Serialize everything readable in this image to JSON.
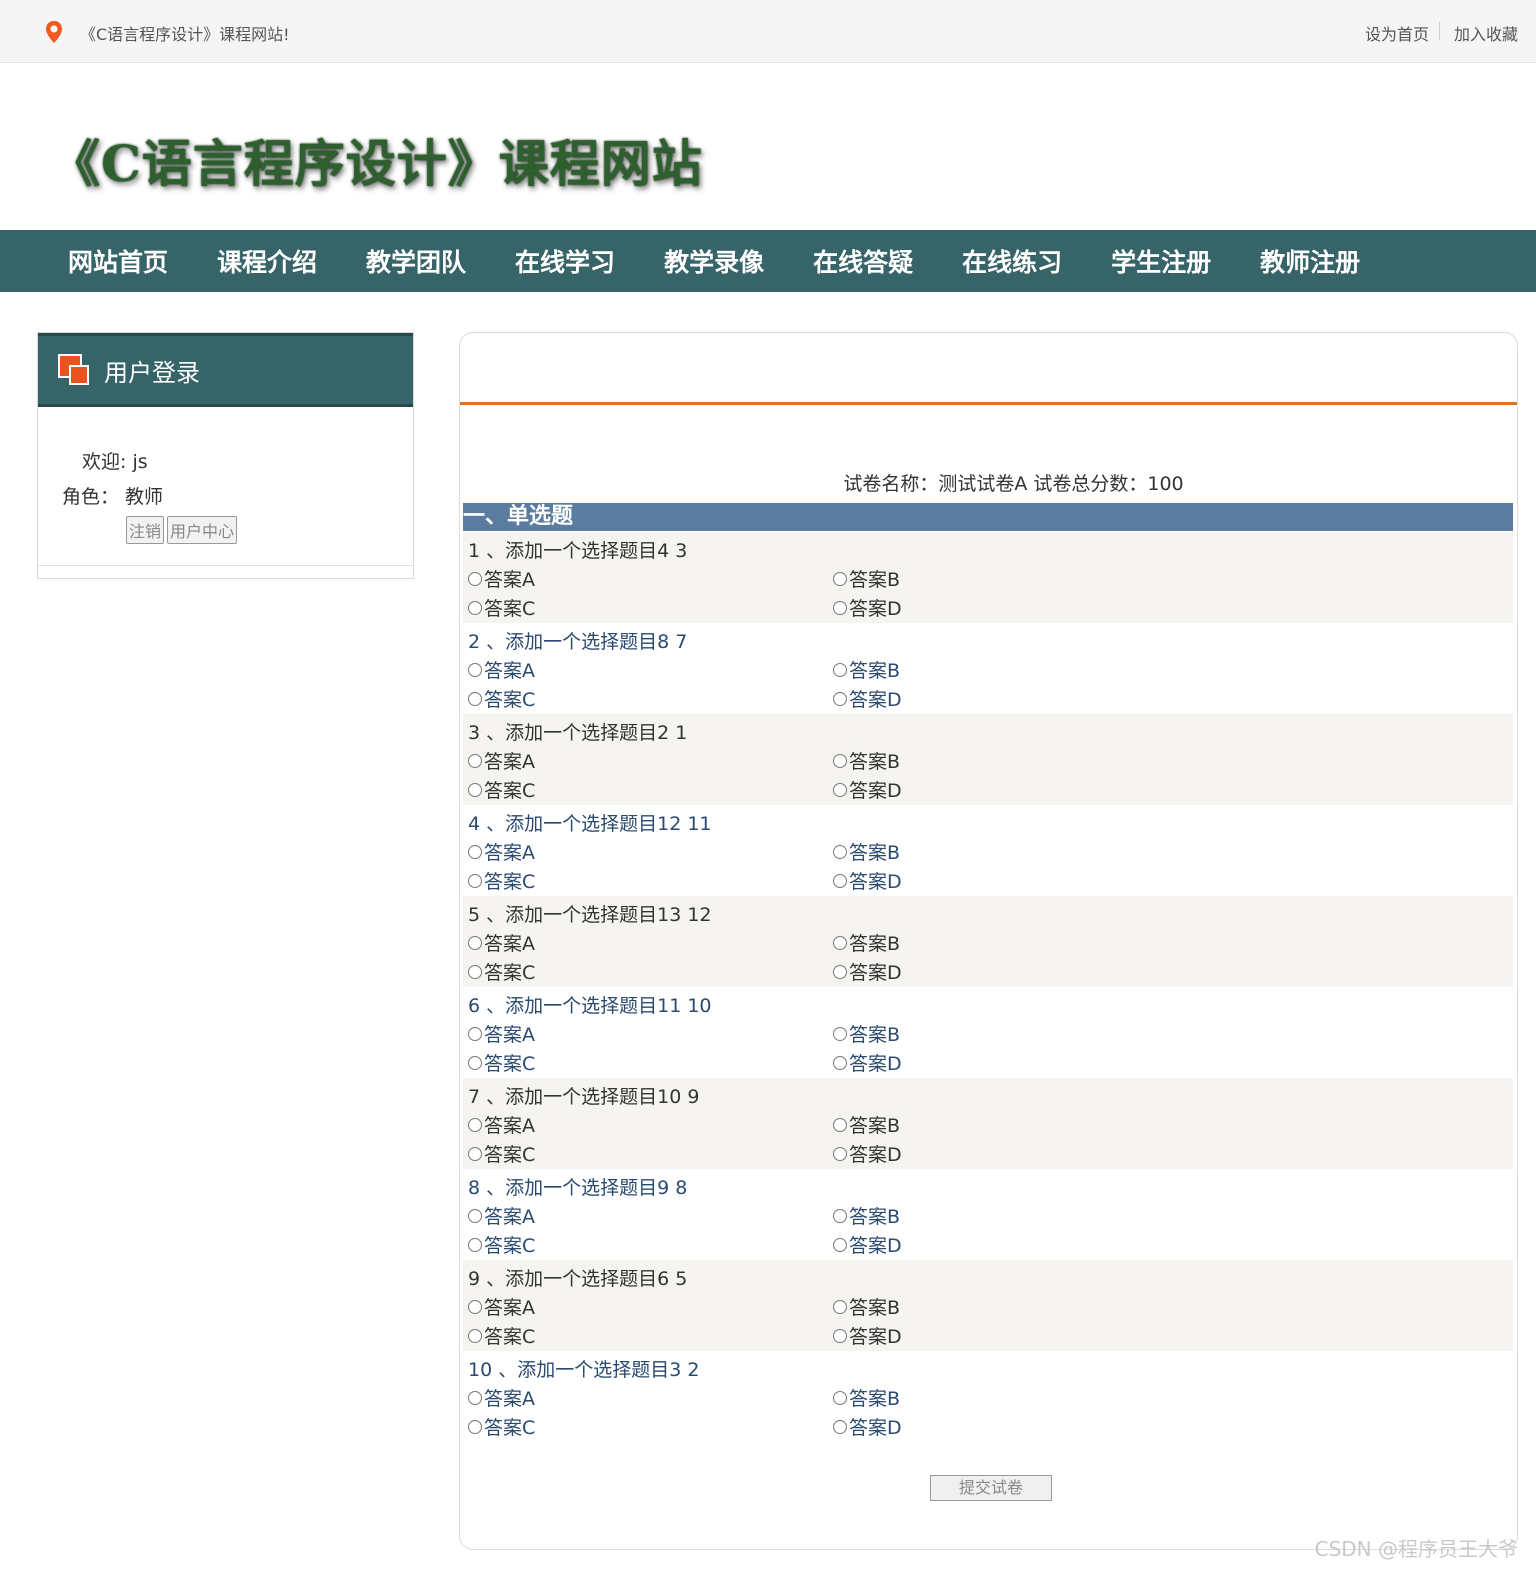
{
  "topbar": {
    "welcome": "《C语言程序设计》课程网站!",
    "set_home": "设为首页",
    "bookmark": "加入收藏"
  },
  "banner": {
    "title": "《C语言程序设计》课程网站"
  },
  "nav": {
    "items": [
      {
        "label": "网站首页"
      },
      {
        "label": "课程介绍"
      },
      {
        "label": "教学团队"
      },
      {
        "label": "在线学习"
      },
      {
        "label": "教学录像"
      },
      {
        "label": "在线答疑"
      },
      {
        "label": "在线练习"
      },
      {
        "label": "学生注册"
      },
      {
        "label": "教师注册"
      }
    ]
  },
  "sidebar": {
    "title": "用户登录",
    "welcome": "欢迎: js",
    "role": "角色：  教师",
    "logout_label": "注销",
    "user_center_label": "用户中心"
  },
  "exam": {
    "summary": "试卷名称：测试试卷A 试卷总分数：100",
    "section_title": "一、单选题",
    "submit_label": "提交试卷",
    "questions": [
      {
        "title": "1 、添加一个选择题目4 3",
        "a": "答案A",
        "b": "答案B",
        "c": "答案C",
        "d": "答案D"
      },
      {
        "title": "2 、添加一个选择题目8 7",
        "a": "答案A",
        "b": "答案B",
        "c": "答案C",
        "d": "答案D"
      },
      {
        "title": "3 、添加一个选择题目2 1",
        "a": "答案A",
        "b": "答案B",
        "c": "答案C",
        "d": "答案D"
      },
      {
        "title": "4 、添加一个选择题目12 11",
        "a": "答案A",
        "b": "答案B",
        "c": "答案C",
        "d": "答案D"
      },
      {
        "title": "5 、添加一个选择题目13 12",
        "a": "答案A",
        "b": "答案B",
        "c": "答案C",
        "d": "答案D"
      },
      {
        "title": "6 、添加一个选择题目11 10",
        "a": "答案A",
        "b": "答案B",
        "c": "答案C",
        "d": "答案D"
      },
      {
        "title": "7 、添加一个选择题目10 9",
        "a": "答案A",
        "b": "答案B",
        "c": "答案C",
        "d": "答案D"
      },
      {
        "title": "8 、添加一个选择题目9 8",
        "a": "答案A",
        "b": "答案B",
        "c": "答案C",
        "d": "答案D"
      },
      {
        "title": "9 、添加一个选择题目6 5",
        "a": "答案A",
        "b": "答案B",
        "c": "答案C",
        "d": "答案D"
      },
      {
        "title": "10 、添加一个选择题目3 2",
        "a": "答案A",
        "b": "答案B",
        "c": "答案C",
        "d": "答案D"
      }
    ]
  },
  "watermark": "CSDN @程序员王大爷",
  "colors": {
    "nav_bg": "#366468",
    "accent_rule": "#d8742b",
    "section_bg": "#5b7b9f",
    "alt_row_bg": "#f5f4f0",
    "banner_text": "#2e5f2e"
  }
}
